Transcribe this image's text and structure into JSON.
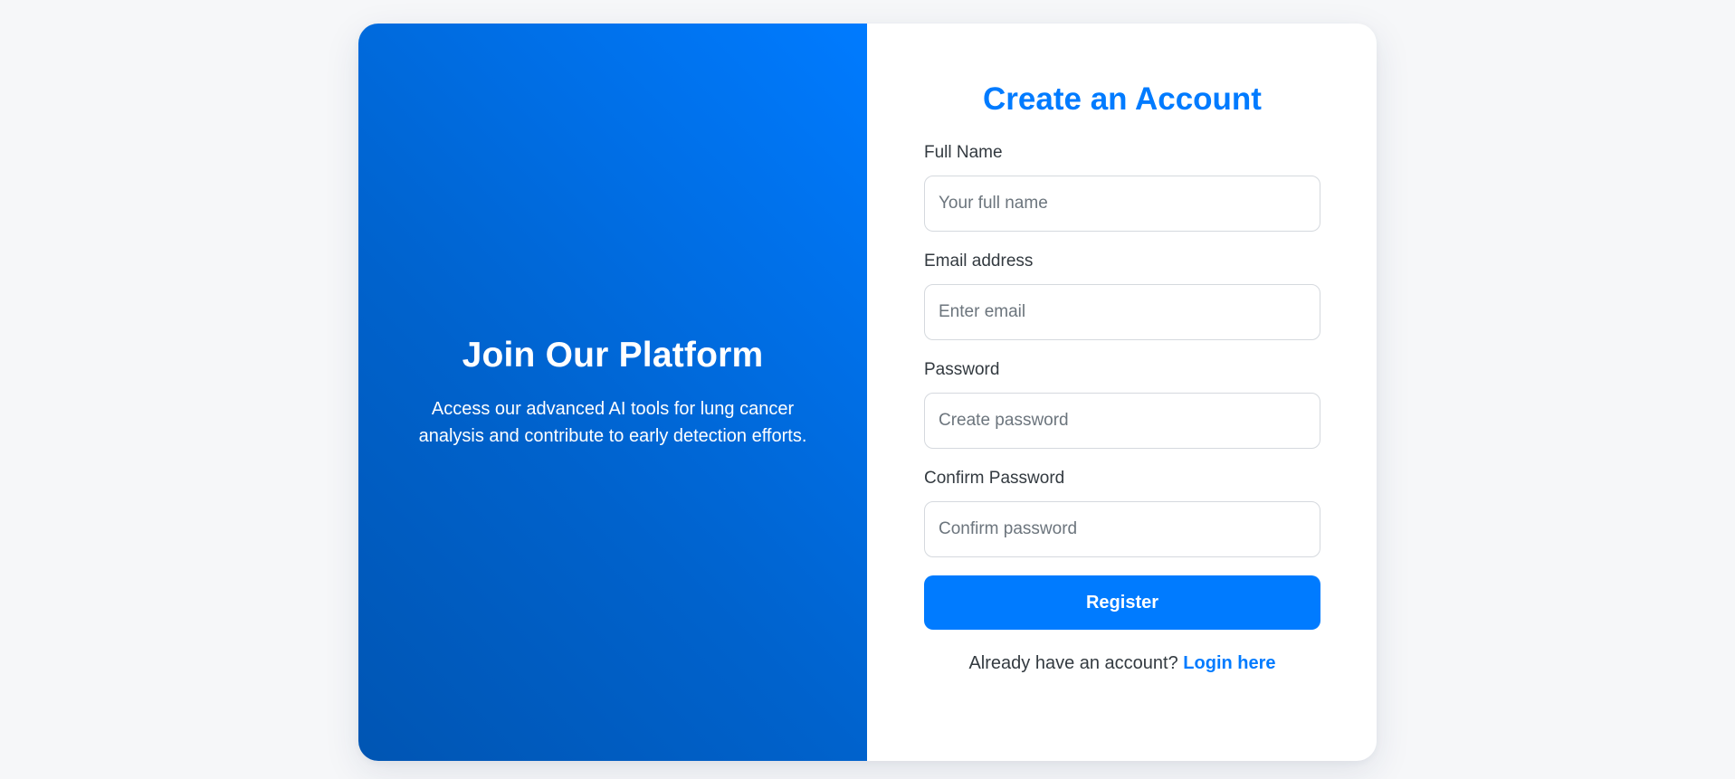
{
  "promo": {
    "title": "Join Our Platform",
    "description": "Access our advanced AI tools for lung cancer analysis and contribute to early detection efforts."
  },
  "form": {
    "title": "Create an Account",
    "fields": [
      {
        "label": "Full Name",
        "placeholder": "Your full name",
        "value": ""
      },
      {
        "label": "Email address",
        "placeholder": "Enter email",
        "value": ""
      },
      {
        "label": "Password",
        "placeholder": "Create password",
        "value": ""
      },
      {
        "label": "Confirm Password",
        "placeholder": "Confirm password",
        "value": ""
      }
    ],
    "submit_label": "Register",
    "login_prompt": "Already have an account?",
    "login_link_label": "Login here"
  },
  "colors": {
    "accent": "#007bff",
    "gradient_dark": "#0055b3",
    "page_background": "#f6f7f9"
  }
}
